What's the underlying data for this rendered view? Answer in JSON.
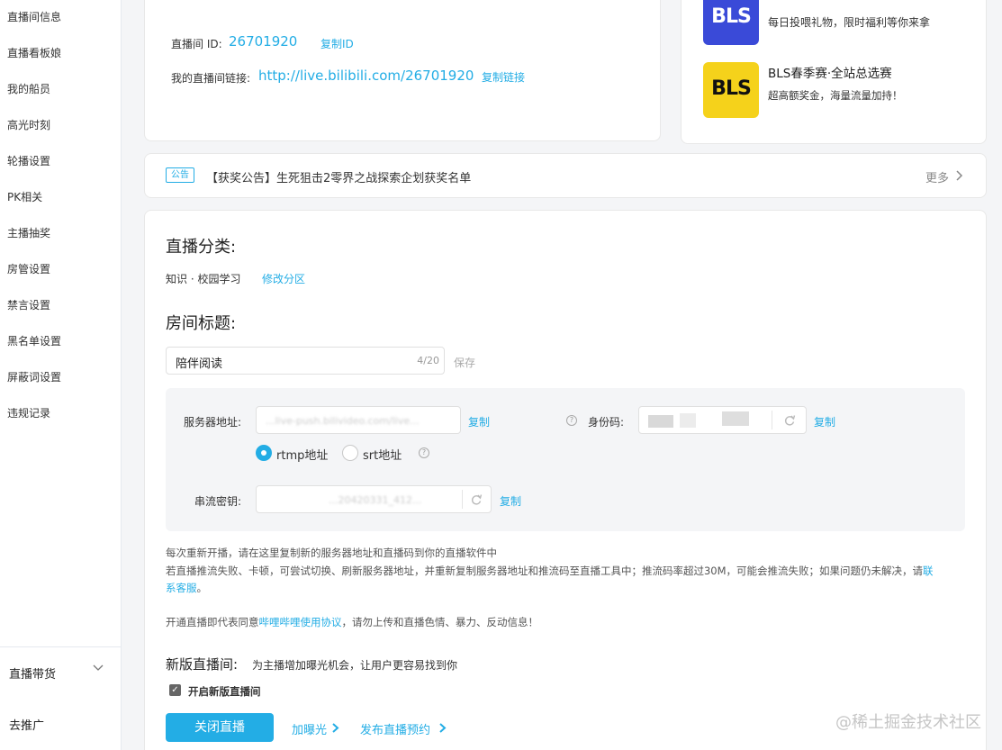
{
  "sidebar": {
    "items": [
      "直播间信息",
      "直播看板娘",
      "我的船员",
      "高光时刻",
      "轮播设置",
      "PK相关",
      "主播抽奖",
      "房管设置",
      "禁言设置",
      "黑名单设置",
      "屏蔽词设置",
      "违规记录"
    ],
    "live_commerce": "直播带货",
    "promote": "去推广"
  },
  "room_info": {
    "id_label": "直播间 ID:",
    "id_value": "26701920",
    "copy_id": "复制ID",
    "link_label": "我的直播间链接:",
    "link_value": "http://live.bilibili.com/26701920",
    "copy_link": "复制链接"
  },
  "promos": [
    {
      "logo": "BLS",
      "title": "",
      "subtitle": "每日投喂礼物，限时福利等你来拿"
    },
    {
      "logo": "BLS",
      "title": "BLS春季赛·全站总选赛",
      "subtitle": "超高额奖金，海量流量加持！"
    }
  ],
  "announcement": {
    "tag": "公告",
    "text": "【获奖公告】生死狙击2零界之战探索企划获奖名单",
    "more": "更多"
  },
  "category": {
    "heading": "直播分类:",
    "value": "知识 · 校园学习",
    "edit": "修改分区"
  },
  "room_title": {
    "heading": "房间标题:",
    "value": "陪伴阅读",
    "counter": "4/20",
    "save": "保存"
  },
  "stream": {
    "server_label": "服务器地址:",
    "server_partial": "...live-push.bilivideo.com/live...",
    "copy": "复制",
    "rtmp": "rtmp地址",
    "srt": "srt地址",
    "id_code_label": "身份码:",
    "key_label": "串流密钥:",
    "key_partial": "...20420331_412...",
    "protocol": "rtmp"
  },
  "notes": {
    "line1": "每次重新开播，请在这里复制新的服务器地址和直播码到你的直播软件中",
    "line2a": "若直播推流失败、卡顿，可尝试切换、刷新服务器地址，并重新复制服务器地址和推流码至直播工具中；推流码率超过30M，可能会推流失败；如果问题仍未解决，请",
    "line2b": "联",
    "line3": "系客服",
    "line3_end": "。",
    "agree_pre": "开通直播即代表同意",
    "agree_link": "哔哩哔哩使用协议",
    "agree_post": "，请勿上传和直播色情、暴力、反动信息！"
  },
  "new_room": {
    "heading": "新版直播间:",
    "desc": "为主播增加曝光机会，让用户更容易找到你",
    "checkbox_label": "开启新版直播间",
    "checked": true
  },
  "actions": {
    "stop": "关闭直播",
    "boost": "加曝光",
    "schedule": "发布直播预约"
  },
  "watermark": "@稀土掘金技术社区",
  "colors": {
    "accent": "#23ade5",
    "bls_blue": "#3a4ad8",
    "bls_yellow": "#f5d21b"
  }
}
